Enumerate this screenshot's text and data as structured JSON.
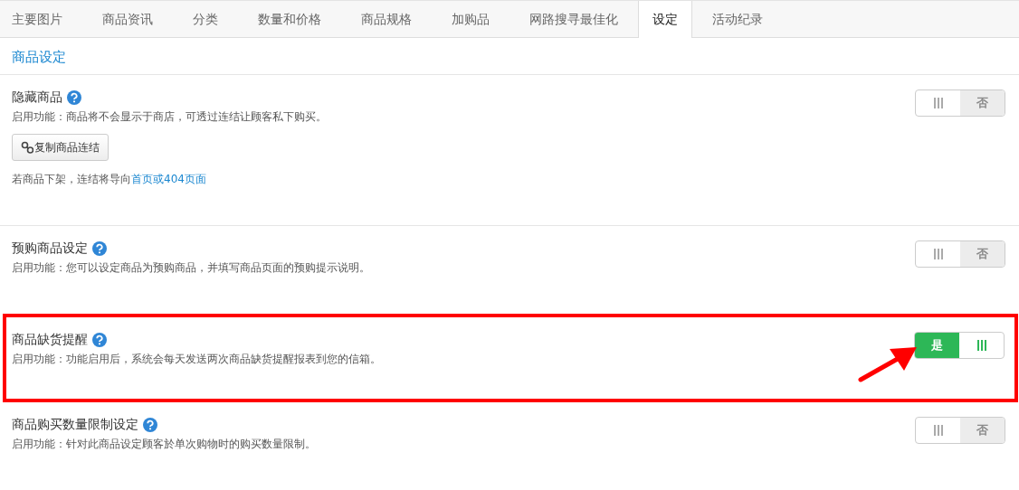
{
  "tabs": [
    {
      "label": "主要图片",
      "selected": false
    },
    {
      "label": "商品资讯",
      "selected": false
    },
    {
      "label": "分类",
      "selected": false
    },
    {
      "label": "数量和价格",
      "selected": false
    },
    {
      "label": "商品规格",
      "selected": false
    },
    {
      "label": "加购品",
      "selected": false
    },
    {
      "label": "网路搜寻最佳化",
      "selected": false
    },
    {
      "label": "设定",
      "selected": true
    },
    {
      "label": "活动纪录",
      "selected": false
    }
  ],
  "section_title": "商品设定",
  "settings": [
    {
      "title": "隐藏商品",
      "description": "启用功能：商品将不会显示于商店，可透过连结让顾客私下购买。",
      "button": "复制商品连结",
      "note": "若商品下架，连结将导向",
      "note_link": "首页或404页面",
      "on": false,
      "toggle_label": "否",
      "highlighted": false
    },
    {
      "title": "预购商品设定",
      "description": "启用功能：您可以设定商品为预购商品，并填写商品页面的预购提示说明。",
      "on": false,
      "toggle_label": "否",
      "highlighted": false
    },
    {
      "title": "商品缺货提醒",
      "description": "启用功能：功能启用后，系统会每天发送两次商品缺货提醒报表到您的信箱。",
      "on": true,
      "toggle_label": "是",
      "highlighted": true
    },
    {
      "title": "商品购买数量限制设定",
      "description": "启用功能：针对此商品设定顾客於单次购物时的购买数量限制。",
      "on": false,
      "toggle_label": "否",
      "highlighted": false
    }
  ]
}
